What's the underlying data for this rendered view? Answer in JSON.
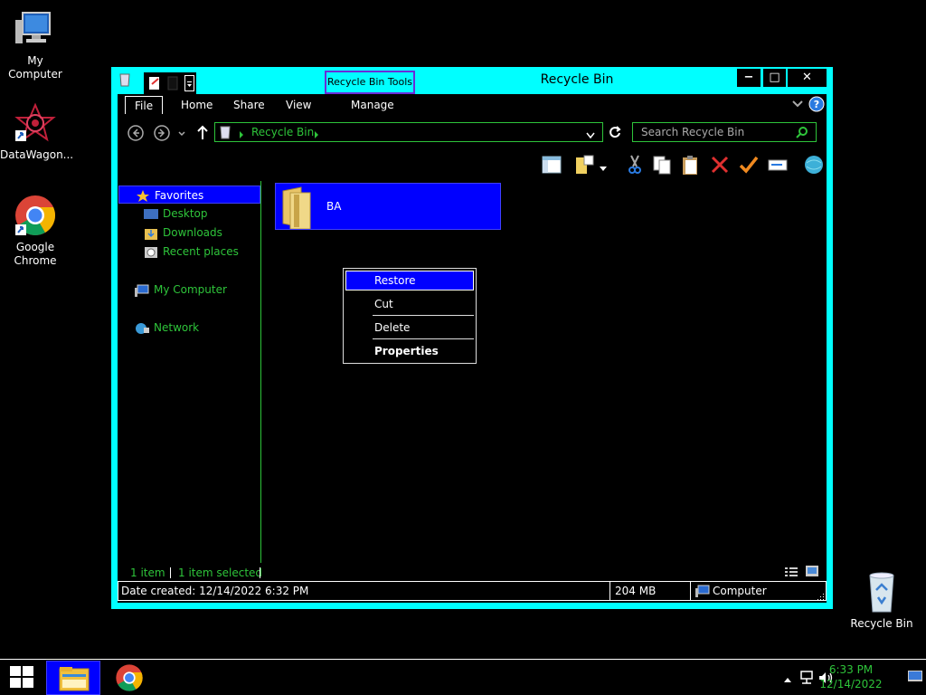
{
  "desktop": {
    "icons": [
      {
        "label": "My Computer"
      },
      {
        "label": "DataWagon..."
      },
      {
        "label": "Google Chrome"
      },
      {
        "label": "Recycle Bin"
      }
    ]
  },
  "window": {
    "title": "Recycle Bin",
    "context_tab": "Recycle Bin Tools",
    "controls": {
      "minimize": "−",
      "maximize": "□",
      "close": "✕"
    },
    "ribbon_tabs": [
      "File",
      "Home",
      "Share",
      "View",
      "Manage"
    ],
    "address": {
      "path": "Recycle Bin"
    },
    "search": {
      "placeholder": "Search Recycle Bin"
    },
    "nav": {
      "favorites": "Favorites",
      "items": [
        "Desktop",
        "Downloads",
        "Recent places"
      ],
      "computer": "My Computer",
      "network": "Network"
    },
    "file": {
      "name": "BA"
    },
    "context_menu": {
      "items": [
        "Restore",
        "Cut",
        "Delete",
        "Properties"
      ],
      "highlighted": "Restore"
    },
    "status": {
      "count": "1 item",
      "selected": "1 item selected"
    },
    "details": {
      "date_created": "Date created: 12/14/2022 6:32 PM",
      "size": "204 MB",
      "location": "Computer"
    }
  },
  "taskbar": {
    "time": "6:33 PM",
    "date": "12/14/2022"
  },
  "colors": {
    "accent": "#00ffff",
    "selection": "#0000ff",
    "text_green": "#2ec43a",
    "tools_border": "#6a2cd9"
  }
}
